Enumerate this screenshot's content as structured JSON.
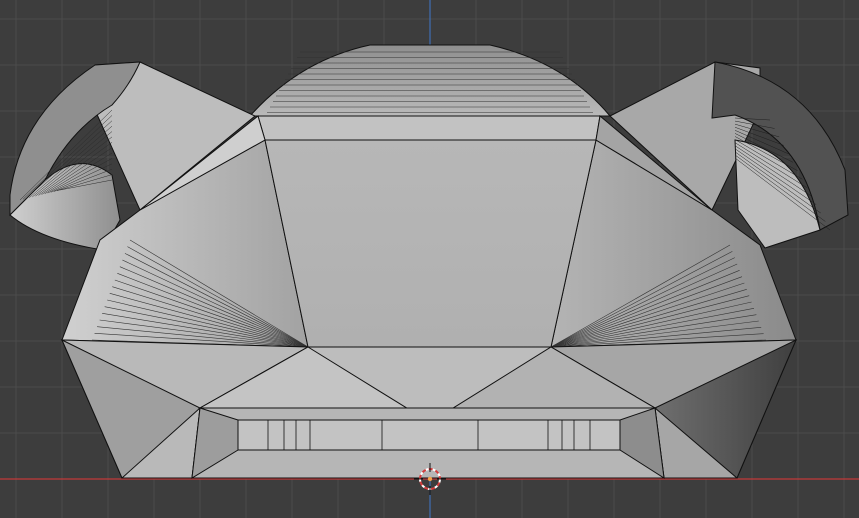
{
  "viewport": {
    "background": "#3d3d3d",
    "grid_color": "#4b4b4b",
    "x_axis_color": "#c23a3a",
    "z_axis_color": "#3f6fb4",
    "mesh_base": "#8f8f8f",
    "mesh_light": "#cbcbcb",
    "mesh_mid": "#a9a9a9",
    "mesh_dark": "#5f5f5f",
    "mesh_darker": "#4a4a4a",
    "edge_color": "#111111",
    "cursor_icon": "3d-cursor-icon"
  }
}
